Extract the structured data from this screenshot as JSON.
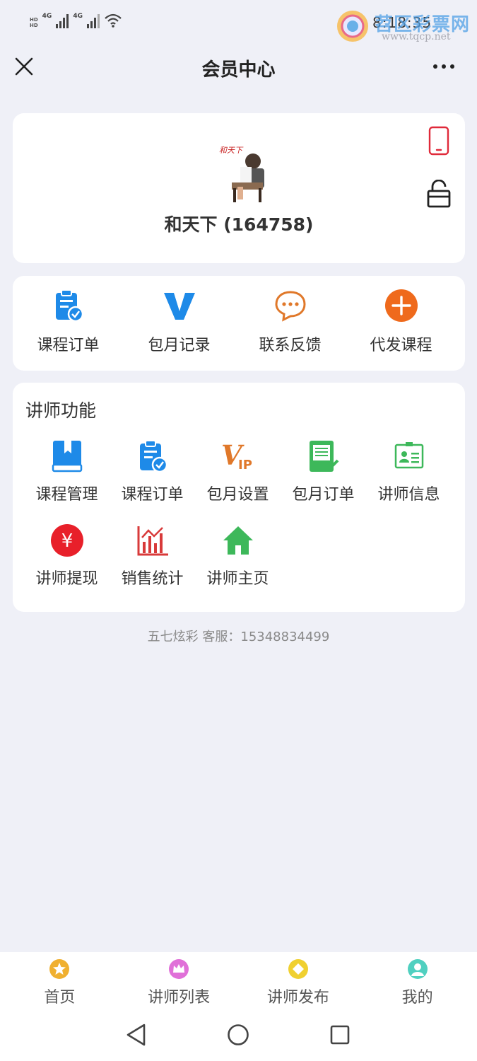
{
  "status_bar": {
    "hd_label": "HD",
    "net_label": "4G",
    "time": "8:18:35",
    "watermark_title": "苕区彩票网",
    "watermark_url": "www.tqcp.net"
  },
  "header": {
    "title": "会员中心"
  },
  "profile": {
    "username": "和天下 (164758)",
    "avatar_sign_text": "和天下"
  },
  "quick_menu": [
    {
      "label": "课程订单",
      "icon": "clipboard-check-icon",
      "color": "#1e8ae8"
    },
    {
      "label": "包月记录",
      "icon": "vip-v-icon",
      "color": "#1e8ae8"
    },
    {
      "label": "联系反馈",
      "icon": "chat-bubble-icon",
      "color": "#e0782a"
    },
    {
      "label": "代发课程",
      "icon": "plus-circle-icon",
      "color": "#ef6a1c"
    }
  ],
  "teacher": {
    "title": "讲师功能",
    "items": [
      {
        "label": "课程管理",
        "icon": "book-icon",
        "color": "#1e8ae8"
      },
      {
        "label": "课程订单",
        "icon": "clipboard-check-icon",
        "color": "#1e8ae8"
      },
      {
        "label": "包月设置",
        "icon": "vip-icon",
        "color": "#e0782a",
        "text": "V",
        "subtext": "IP"
      },
      {
        "label": "包月订单",
        "icon": "document-check-icon",
        "color": "#3db85a"
      },
      {
        "label": "讲师信息",
        "icon": "id-card-icon",
        "color": "#3db85a"
      },
      {
        "label": "讲师提现",
        "icon": "yuan-coin-icon",
        "color": "#e8202a",
        "text": "¥"
      },
      {
        "label": "销售统计",
        "icon": "bar-chart-icon",
        "color": "#d83a3a"
      },
      {
        "label": "讲师主页",
        "icon": "home-icon",
        "color": "#3db85a"
      }
    ]
  },
  "service_text": "五七炫彩 客服：15348834499",
  "tabbar": [
    {
      "label": "首页",
      "icon": "star-icon",
      "color": "#f0b030"
    },
    {
      "label": "讲师列表",
      "icon": "crown-icon",
      "color": "#e070d8"
    },
    {
      "label": "讲师发布",
      "icon": "diamond-icon",
      "color": "#f0d030"
    },
    {
      "label": "我的",
      "icon": "user-icon",
      "color": "#50d0c0"
    }
  ]
}
